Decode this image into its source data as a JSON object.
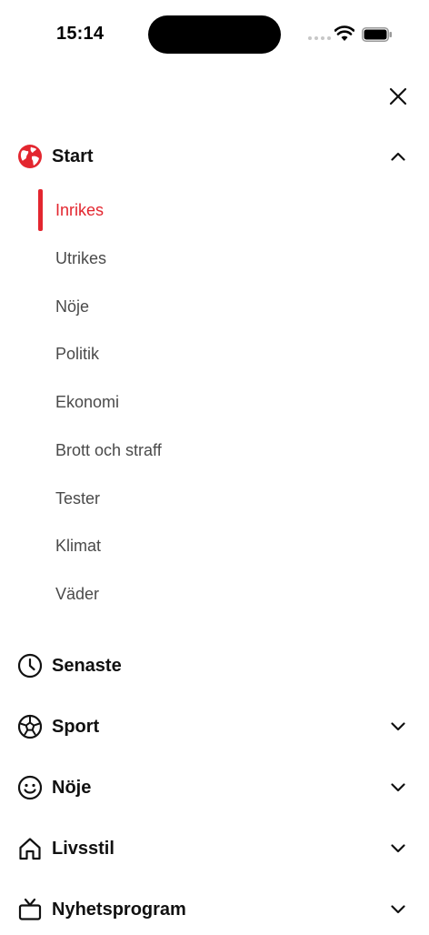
{
  "status": {
    "time": "15:14"
  },
  "menu": {
    "start": {
      "label": "Start",
      "items": [
        {
          "label": "Inrikes"
        },
        {
          "label": "Utrikes"
        },
        {
          "label": "Nöje"
        },
        {
          "label": "Politik"
        },
        {
          "label": "Ekonomi"
        },
        {
          "label": "Brott och straff"
        },
        {
          "label": "Tester"
        },
        {
          "label": "Klimat"
        },
        {
          "label": "Väder"
        }
      ],
      "active_index": 0
    },
    "senaste": {
      "label": "Senaste"
    },
    "sport": {
      "label": "Sport"
    },
    "noje": {
      "label": "Nöje"
    },
    "livsstil": {
      "label": "Livsstil"
    },
    "nyhetsprogram": {
      "label": "Nyhetsprogram"
    }
  },
  "colors": {
    "accent": "#e3262f",
    "text": "#111111",
    "sub_text": "#4a4a4a"
  },
  "icons": {
    "start": "globe-icon",
    "senaste": "clock-icon",
    "sport": "soccer-ball-icon",
    "noje": "smiley-icon",
    "livsstil": "home-icon",
    "nyhetsprogram": "tv-icon"
  }
}
